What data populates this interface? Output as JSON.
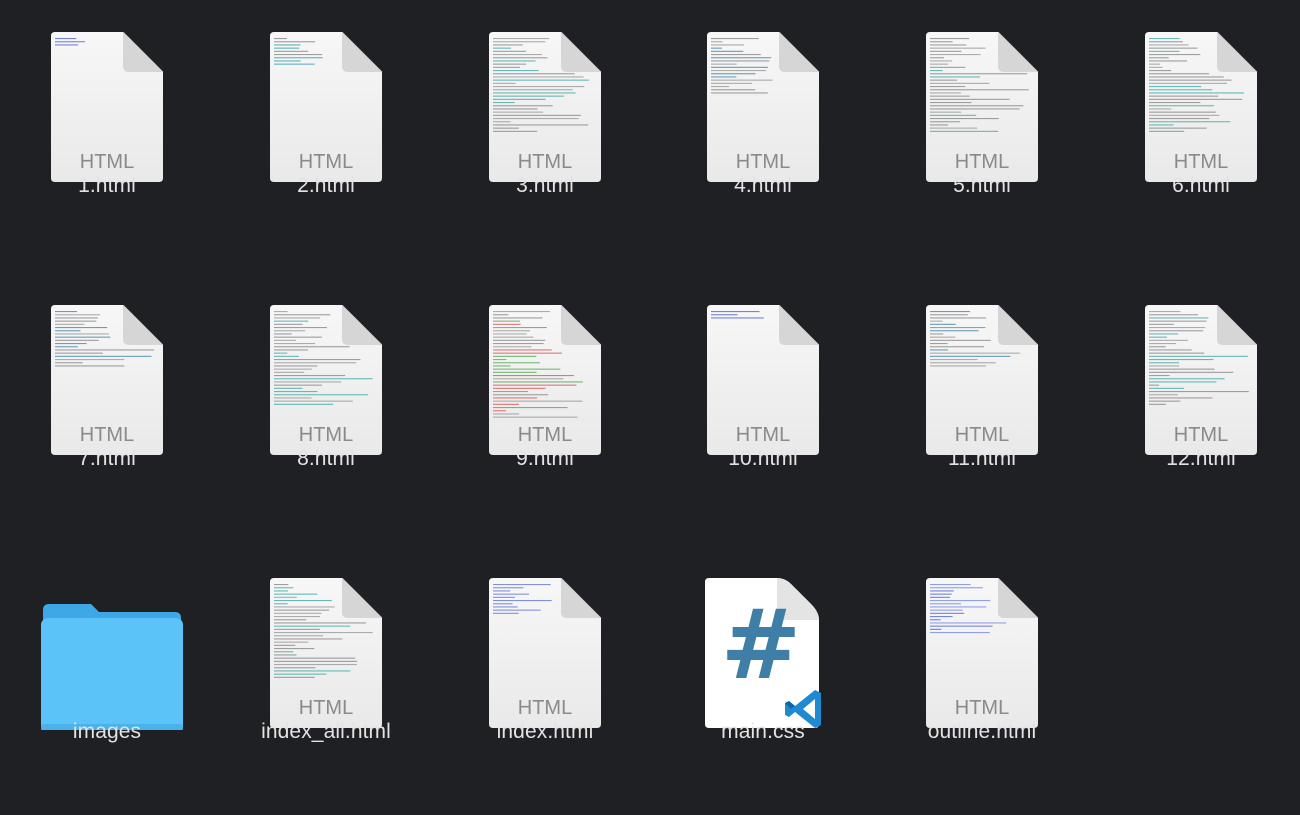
{
  "window": {
    "background": "#1f2023"
  },
  "files": [
    {
      "name": "1.html",
      "kind": "html",
      "badge": "HTML",
      "icon": "html-document-icon",
      "preview": "sparse"
    },
    {
      "name": "2.html",
      "kind": "html",
      "badge": "HTML",
      "icon": "html-document-icon",
      "preview": "short"
    },
    {
      "name": "3.html",
      "kind": "html",
      "badge": "HTML",
      "icon": "html-document-icon",
      "preview": "dense"
    },
    {
      "name": "4.html",
      "kind": "html",
      "badge": "HTML",
      "icon": "html-document-icon",
      "preview": "medium"
    },
    {
      "name": "5.html",
      "kind": "html",
      "badge": "HTML",
      "icon": "html-document-icon",
      "preview": "dense"
    },
    {
      "name": "6.html",
      "kind": "html",
      "badge": "HTML",
      "icon": "html-document-icon",
      "preview": "dense"
    },
    {
      "name": "7.html",
      "kind": "html",
      "badge": "HTML",
      "icon": "html-document-icon",
      "preview": "medium"
    },
    {
      "name": "8.html",
      "kind": "html",
      "badge": "HTML",
      "icon": "html-document-icon",
      "preview": "dense"
    },
    {
      "name": "9.html",
      "kind": "html",
      "badge": "HTML",
      "icon": "html-document-icon",
      "preview": "colorful"
    },
    {
      "name": "10.html",
      "kind": "html",
      "badge": "HTML",
      "icon": "html-document-icon",
      "preview": "sparse"
    },
    {
      "name": "11.html",
      "kind": "html",
      "badge": "HTML",
      "icon": "html-document-icon",
      "preview": "medium"
    },
    {
      "name": "12.html",
      "kind": "html",
      "badge": "HTML",
      "icon": "html-document-icon",
      "preview": "dense"
    },
    {
      "name": "images",
      "kind": "folder",
      "badge": "",
      "icon": "folder-icon",
      "preview": "none"
    },
    {
      "name": "index_all.html",
      "kind": "html",
      "badge": "HTML",
      "icon": "html-document-icon",
      "preview": "dense"
    },
    {
      "name": "index.html",
      "kind": "html",
      "badge": "HTML",
      "icon": "html-document-icon",
      "preview": "links"
    },
    {
      "name": "main.css",
      "kind": "css",
      "badge": "",
      "icon": "css-file-vscode-icon",
      "preview": "none"
    },
    {
      "name": "outline.html",
      "kind": "html",
      "badge": "HTML",
      "icon": "html-document-icon",
      "preview": "outline"
    }
  ],
  "colors": {
    "label_text": "#e3e3e3",
    "folder_blue": "#5bc3f7",
    "css_hash": "#3f7ea6",
    "vscode_blue": "#1f8ad2"
  }
}
